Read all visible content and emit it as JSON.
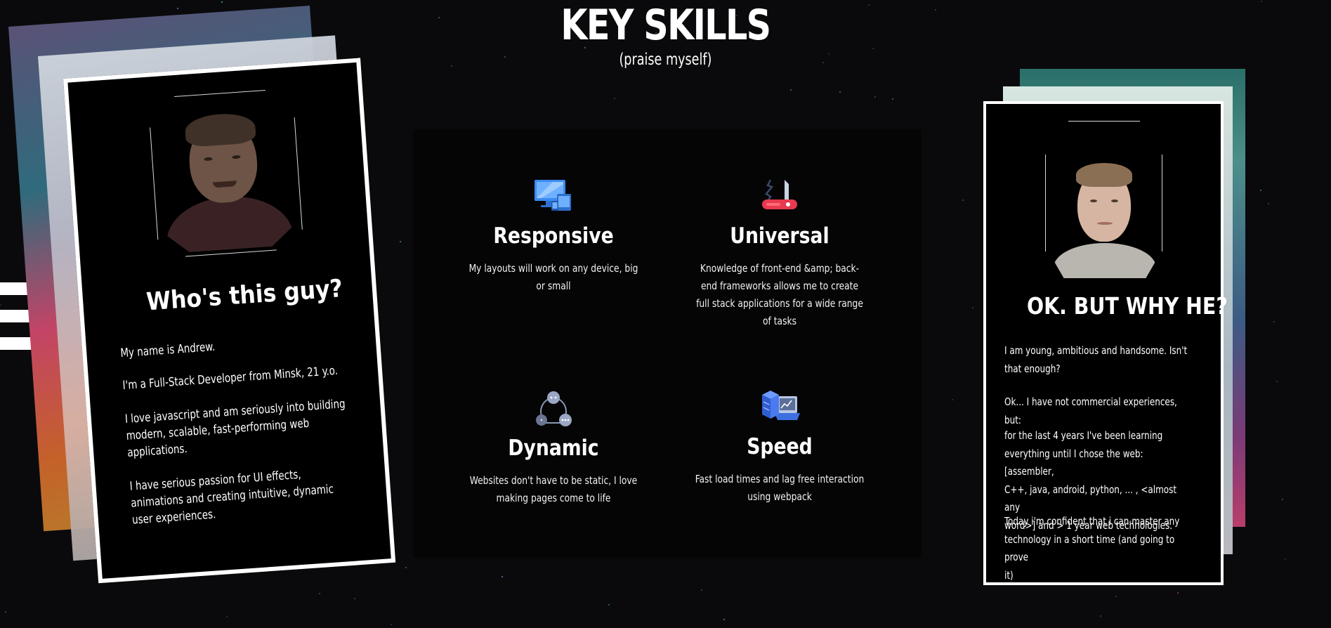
{
  "header": {
    "title": "KEY SKILLS",
    "subtitle": "(praise myself)"
  },
  "menu": {
    "icon": "hamburger-menu-icon"
  },
  "left_card": {
    "heading": "Who's this guy?",
    "paragraphs": [
      "My name is Andrew.",
      "I'm a Full-Stack Developer from Minsk, 21 y.o.",
      "I love javascript and am seriously into building\nmodern, scalable, fast-performing web\napplications.",
      "I have serious passion for UI effects,\nanimations and creating intuitive, dynamic\nuser experiences."
    ],
    "photo": "portrait-photo-smiling"
  },
  "skills": [
    {
      "icon": "responsive-devices-icon",
      "title": "Responsive",
      "description": "My layouts will work on any device, big or small"
    },
    {
      "icon": "swiss-knife-icon",
      "title": "Universal",
      "description": "Knowledge of front-end &amp; back-end frameworks allows me to create full stack applications for a wide range of tasks"
    },
    {
      "icon": "dynamic-chat-icon",
      "title": "Dynamic",
      "description": "Websites don't have to be static, I love making pages come to life"
    },
    {
      "icon": "speed-server-icon",
      "title": "Speed",
      "description": "Fast load times and lag free interaction using webpack"
    }
  ],
  "right_card": {
    "heading": "OK. BUT WHY HE?",
    "paragraphs": [
      "I am young, ambitious and handsome. Isn't\nthat enough?",
      "Ok... I have not commercial experiences, but:",
      "for the last 4 years I've been learning\neverything until I chose the web: [assembler,\nC++, java, android, python, ... , <almost any\nword>] and > 1 year web technologies.",
      "Today i'm confident that i can master any\ntechnology in a short time (and going to prove\nit)"
    ],
    "photo": "portrait-photo-neutral"
  },
  "colors": {
    "background": "#0a0a0c",
    "accent_blue": "#3d8bf0",
    "accent_red": "#e8394f"
  }
}
